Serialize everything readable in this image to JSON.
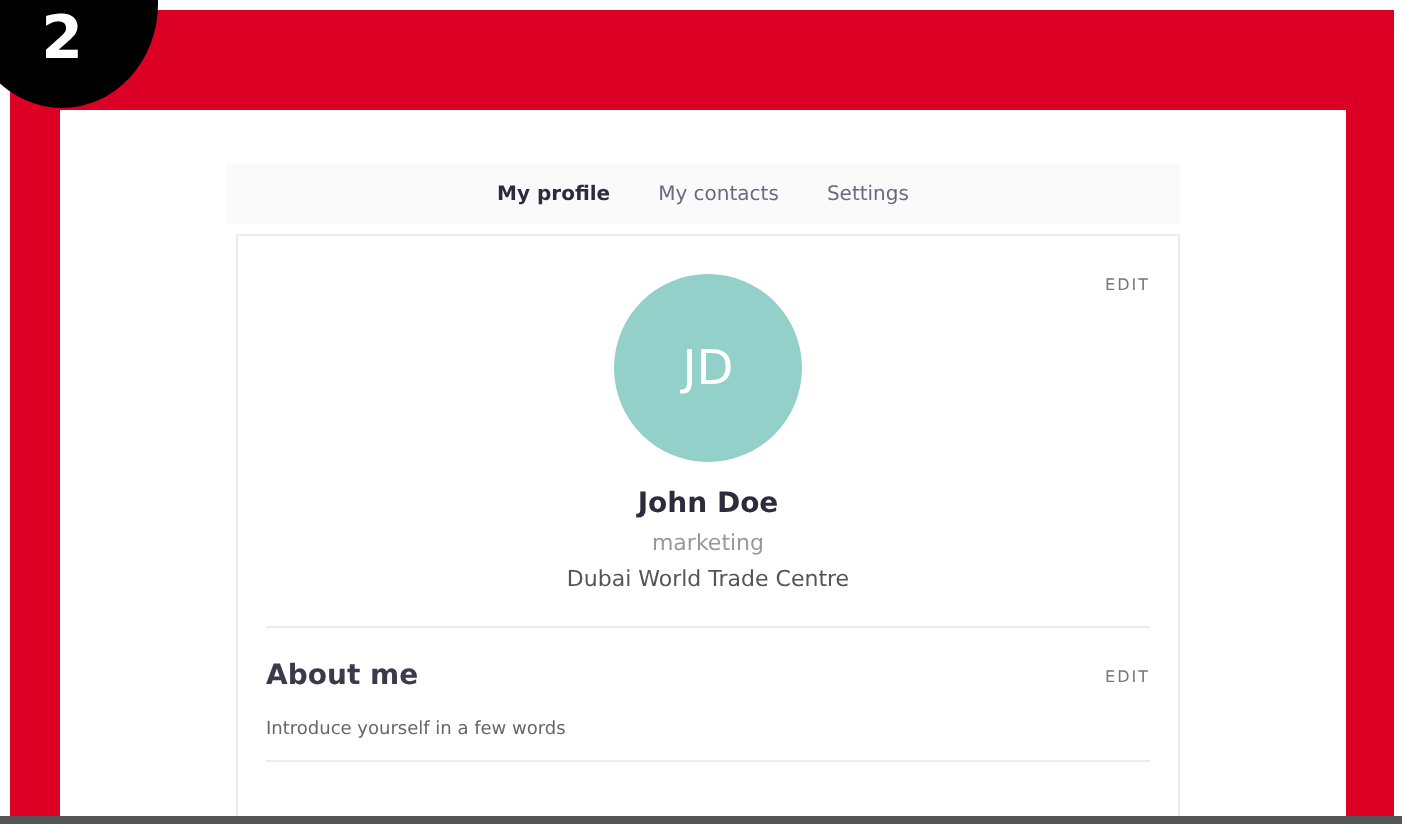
{
  "step_badge": "2",
  "tabs": [
    {
      "label": "My profile",
      "selected": true
    },
    {
      "label": "My contacts",
      "selected": false
    },
    {
      "label": "Settings",
      "selected": false
    }
  ],
  "profile": {
    "edit": "EDIT",
    "initials": "JD",
    "name": "John Doe",
    "role": "marketing",
    "location": "Dubai World Trade Centre"
  },
  "about": {
    "title": "About me",
    "edit": "EDIT",
    "intro": "Introduce yourself in a few words"
  }
}
